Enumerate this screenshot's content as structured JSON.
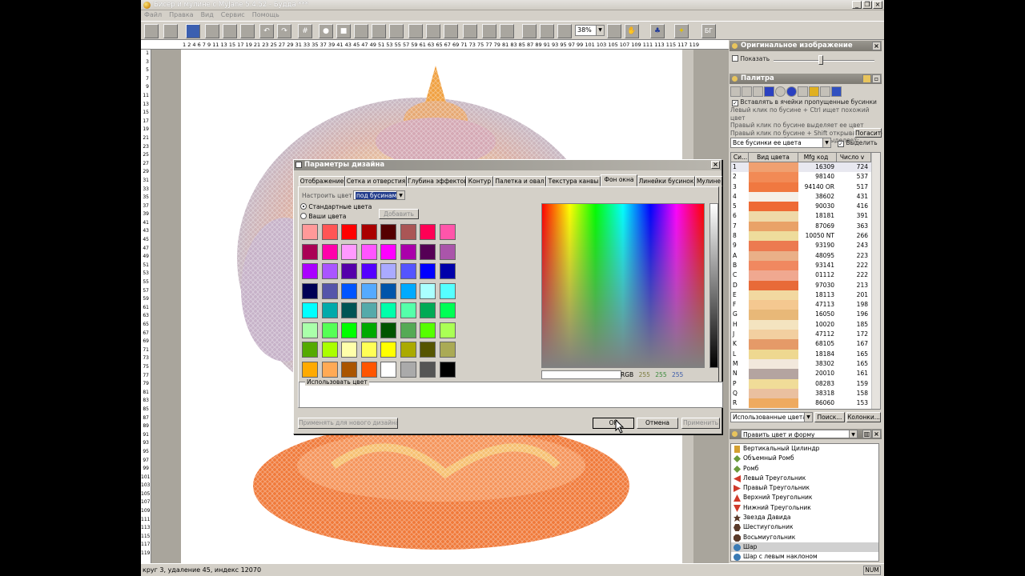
{
  "window": {
    "title": "Бисер и мулине с MyJane 5.4.52 - Будда ***"
  },
  "menu": [
    "Файл",
    "Правка",
    "Вид",
    "Сервис",
    "Помощь"
  ],
  "toolbar": {
    "zoom": "38%"
  },
  "ruler": {
    "top": "1 2 4 6 7 9 11 13 15 17 19 21 23 25 27 29 31 33 35 37 39 41 43 45 47 49 51 53 55 57 59 61 63 65 67 69 71 73 75 77 79 81 83 85 87 89 91 93 95 97 99 101 103 105 107 109 111 113 115 117 119",
    "left": [
      "1",
      "3",
      "5",
      "7",
      "9",
      "11",
      "13",
      "15",
      "17",
      "19",
      "21",
      "23",
      "25",
      "27",
      "29",
      "31",
      "33",
      "35",
      "37",
      "39",
      "41",
      "43",
      "45",
      "47",
      "49",
      "51",
      "53",
      "55",
      "57",
      "59",
      "61",
      "63",
      "65",
      "67",
      "69",
      "71",
      "73",
      "75",
      "77",
      "79",
      "81",
      "83",
      "85",
      "87",
      "89",
      "91",
      "93",
      "95",
      "97",
      "99",
      "101",
      "103",
      "105",
      "107",
      "109",
      "111",
      "113",
      "115",
      "117",
      "119"
    ]
  },
  "original_panel": {
    "title": "Оригинальное изображение",
    "show_label": "Показать"
  },
  "palette_panel": {
    "title": "Палитра",
    "insert_label": "Вставлять в ячейки пропущенные бусинки",
    "help": [
      "Левый  клик по бусине + Ctrl ищет похожий цвет",
      "Правый клик по бусине выделяет ее цвет",
      "Правый клик по бусине + Shift открывает меню",
      "Правый клик по бусине + Ctrl выделяет:"
    ],
    "extinguish_button": "Погасить",
    "filter_value": "Все бусинки ее цвета",
    "highlight_label": "Выделить",
    "columns": [
      "Си...",
      "Вид цвета",
      "Mfg код",
      "Число v"
    ],
    "rows": [
      {
        "sym": "1",
        "color": "#f0a070",
        "code": "16309",
        "count": "724"
      },
      {
        "sym": "2",
        "color": "#f28a55",
        "code": "98140",
        "count": "537"
      },
      {
        "sym": "3",
        "color": "#f07840",
        "code": "94140 OR",
        "count": "517"
      },
      {
        "sym": "4",
        "color": "#f5f0e8",
        "code": "38602",
        "count": "431"
      },
      {
        "sym": "5",
        "color": "#ee6a35",
        "code": "90030",
        "count": "416"
      },
      {
        "sym": "6",
        "color": "#efd9a8",
        "code": "18181",
        "count": "391"
      },
      {
        "sym": "7",
        "color": "#e9a268",
        "code": "87069",
        "count": "363"
      },
      {
        "sym": "8",
        "color": "#eedc9c",
        "code": "10050 NT",
        "count": "266"
      },
      {
        "sym": "9",
        "color": "#ec7a50",
        "code": "93190",
        "count": "243"
      },
      {
        "sym": "A",
        "color": "#eab088",
        "code": "48095",
        "count": "223"
      },
      {
        "sym": "B",
        "color": "#f08860",
        "code": "93141",
        "count": "222"
      },
      {
        "sym": "C",
        "color": "#f0a890",
        "code": "01112",
        "count": "222"
      },
      {
        "sym": "D",
        "color": "#e86a38",
        "code": "97030",
        "count": "213"
      },
      {
        "sym": "E",
        "color": "#f2d8a0",
        "code": "18113",
        "count": "201"
      },
      {
        "sym": "F",
        "color": "#f4c890",
        "code": "47113",
        "count": "198"
      },
      {
        "sym": "G",
        "color": "#e8b878",
        "code": "16050",
        "count": "196"
      },
      {
        "sym": "H",
        "color": "#f4e4c0",
        "code": "10020",
        "count": "185"
      },
      {
        "sym": "J",
        "color": "#f2cfa0",
        "code": "47112",
        "count": "172"
      },
      {
        "sym": "K",
        "color": "#e59a68",
        "code": "68105",
        "count": "167"
      },
      {
        "sym": "L",
        "color": "#eed890",
        "code": "18184",
        "count": "165"
      },
      {
        "sym": "M",
        "color": "#f2e8dc",
        "code": "38302",
        "count": "165"
      },
      {
        "sym": "N",
        "color": "#b4a4a0",
        "code": "20010",
        "count": "161"
      },
      {
        "sym": "P",
        "color": "#f0dc98",
        "code": "08283",
        "count": "159"
      },
      {
        "sym": "Q",
        "color": "#eac0a0",
        "code": "38318",
        "count": "158"
      },
      {
        "sym": "R",
        "color": "#eeaa60",
        "code": "86060",
        "count": "153"
      }
    ],
    "used_colors": "Использованные цвета",
    "search_button": "Поиск...",
    "columns_button": "Колонки..."
  },
  "shape_panel": {
    "title": "Править цвет и форму",
    "items": [
      {
        "label": "Вертикальный Цилиндр",
        "icon": "cylinder-icon",
        "color": "#d4a030"
      },
      {
        "label": "Объемный Ромб",
        "icon": "rhombus-icon",
        "color": "#6a9a3a"
      },
      {
        "label": "Ромб",
        "icon": "rhombus-icon",
        "color": "#6a9a3a"
      },
      {
        "label": "Левый Треугольник",
        "icon": "triangle-left-icon",
        "color": "#d03a2a"
      },
      {
        "label": "Правый Треугольник",
        "icon": "triangle-right-icon",
        "color": "#d03a2a"
      },
      {
        "label": "Верхний Треугольник",
        "icon": "triangle-up-icon",
        "color": "#d03a2a"
      },
      {
        "label": "Нижний Треугольник",
        "icon": "triangle-down-icon",
        "color": "#d03a2a"
      },
      {
        "label": "Звезда Давида",
        "icon": "star-icon",
        "color": "#5a3a2a"
      },
      {
        "label": "Шестиугольник",
        "icon": "hexagon-icon",
        "color": "#5a3a2a"
      },
      {
        "label": "Восьмиугольник",
        "icon": "octagon-icon",
        "color": "#5a3a2a"
      },
      {
        "label": "Шар",
        "icon": "sphere-icon",
        "color": "#3a7ab4"
      },
      {
        "label": "Шар с левым наклоном",
        "icon": "sphere-icon",
        "color": "#3a7ab4"
      }
    ]
  },
  "status": {
    "text": "круг 3, удаление 45, индекс 12070",
    "num": "NUM"
  },
  "dialog": {
    "title": "Параметры дизайна",
    "tabs": [
      "Отображение",
      "Сетка и отверстия",
      "Глубина эффектов",
      "Контур",
      "Палетка и овал",
      "Текстура канвы",
      "Фон окна",
      "Линейки бусинок",
      "Мулине"
    ],
    "customize_label": "Настроить цвет",
    "customize_value": "под бусинами",
    "standard_colors": "Стандартные цвета",
    "your_colors": "Ваши цвета",
    "add_button": "Добавить",
    "swatches": [
      "#ff9999",
      "#ff5555",
      "#ff0000",
      "#aa0000",
      "#550000",
      "#aa5555",
      "#ff0055",
      "#ff55aa",
      "#aa0055",
      "#ff00aa",
      "#ff99ff",
      "#ff55ff",
      "#ff00ff",
      "#aa00aa",
      "#550055",
      "#aa55aa",
      "#aa00ff",
      "#aa55ff",
      "#5500aa",
      "#5500ff",
      "#aaaaff",
      "#5555ff",
      "#0000ff",
      "#0000aa",
      "#000055",
      "#5555aa",
      "#0055ff",
      "#55aaff",
      "#0055aa",
      "#00aaff",
      "#aaffff",
      "#55ffff",
      "#00ffff",
      "#00aaaa",
      "#005555",
      "#55aaaa",
      "#00ffaa",
      "#55ffaa",
      "#00aa55",
      "#00ff55",
      "#aaffaa",
      "#55ff55",
      "#00ff00",
      "#00aa00",
      "#005500",
      "#55aa55",
      "#55ff00",
      "#aaff55",
      "#55aa00",
      "#aaff00",
      "#ffffaa",
      "#ffff55",
      "#ffff00",
      "#aaaa00",
      "#555500",
      "#aaaa55",
      "#ffaa00",
      "#ffaa55",
      "#aa5500",
      "#ff5500",
      "#ffffff",
      "#aaaaaa",
      "#555555",
      "#000000"
    ],
    "rgb_label": "RGB",
    "rgb": [
      "255",
      "255",
      "255"
    ],
    "use_color": "Использовать цвет",
    "apply_new_button": "Применять для нового дизайна",
    "ok_button": "OK",
    "cancel_button": "Отмена",
    "apply_button": "Применить"
  }
}
